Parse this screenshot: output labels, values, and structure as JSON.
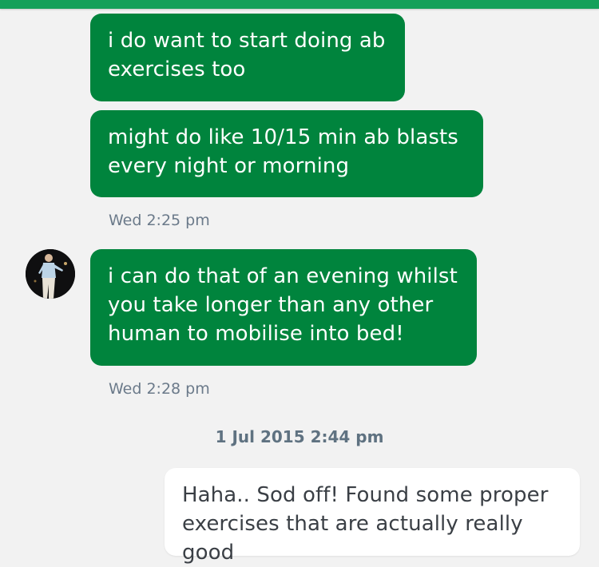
{
  "colors": {
    "top_bar": "#14a05a",
    "incoming_bubble": "#00843d",
    "incoming_text": "#ffffff",
    "outgoing_bubble": "#ffffff",
    "outgoing_text": "#3a3f45",
    "timestamp": "#6b7a8a",
    "background": "#f2f2f2"
  },
  "messages": [
    {
      "direction": "incoming",
      "text": "i do want to start doing ab\nexercises too"
    },
    {
      "direction": "incoming",
      "text": "might do like 10/15 min ab blasts\nevery night or morning"
    },
    {
      "type": "time",
      "text": "Wed 2:25 pm"
    },
    {
      "direction": "incoming",
      "avatar": "contact-avatar",
      "text": "i can do that of an evening whilst\nyou take longer than any other\nhuman to mobilise into bed!"
    },
    {
      "type": "time",
      "text": "Wed 2:28 pm"
    },
    {
      "type": "day_separator",
      "text": "1 Jul 2015 2:44 pm"
    },
    {
      "direction": "outgoing",
      "text": "Haha.. Sod off! Found some proper\nexercises that are actually really good"
    }
  ]
}
